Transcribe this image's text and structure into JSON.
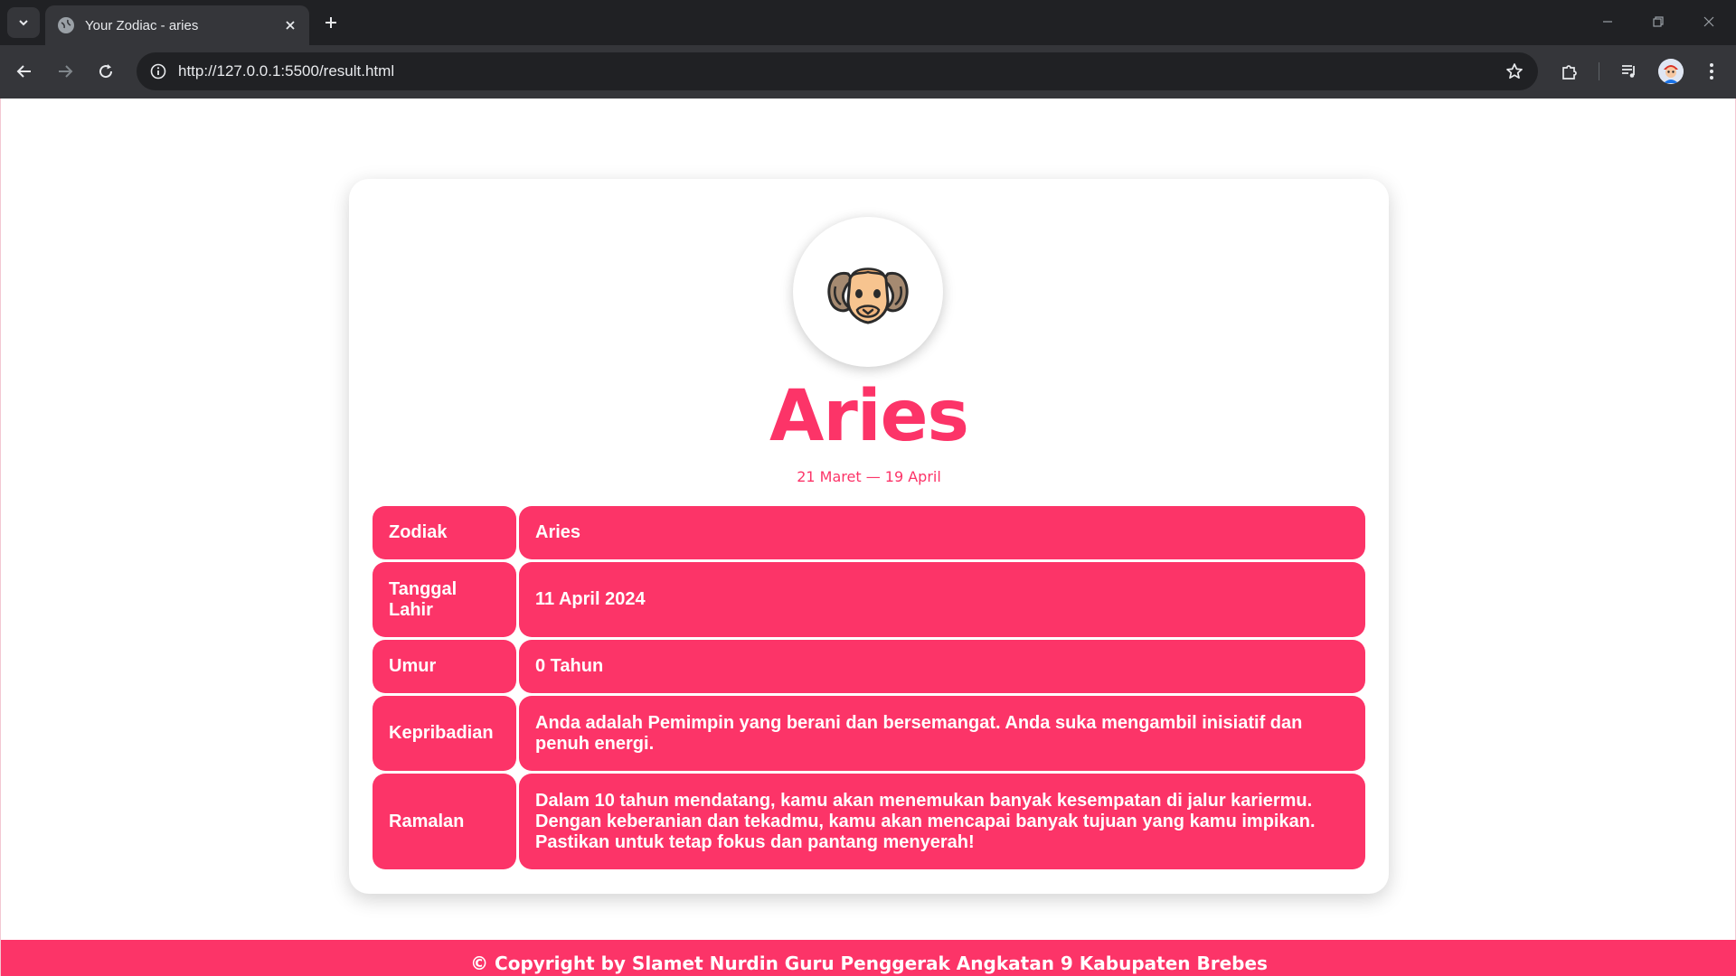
{
  "browser": {
    "tab_title": "Your Zodiac - aries",
    "url": "http://127.0.0.1:5500/result.html"
  },
  "page": {
    "zodiac_name": "Aries",
    "date_range": "21 Maret — 19 April",
    "zodiac_icon": "ram-head-icon",
    "accent_color": "#fc3468",
    "rows": [
      {
        "label": "Zodiak",
        "value": "Aries"
      },
      {
        "label": "Tanggal Lahir",
        "value": "11 April 2024"
      },
      {
        "label": "Umur",
        "value": "0 Tahun"
      },
      {
        "label": "Kepribadian",
        "value": "Anda adalah Pemimpin yang berani dan bersemangat. Anda suka mengambil inisiatif dan penuh energi."
      },
      {
        "label": "Ramalan",
        "value": "Dalam 10 tahun mendatang, kamu akan menemukan banyak kesempatan di jalur kariermu. Dengan keberanian dan tekadmu, kamu akan mencapai banyak tujuan yang kamu impikan. Pastikan untuk tetap fokus dan pantang menyerah!"
      }
    ],
    "footer": "© Copyright by Slamet Nurdin Guru Penggerak Angkatan 9 Kabupaten Brebes"
  }
}
